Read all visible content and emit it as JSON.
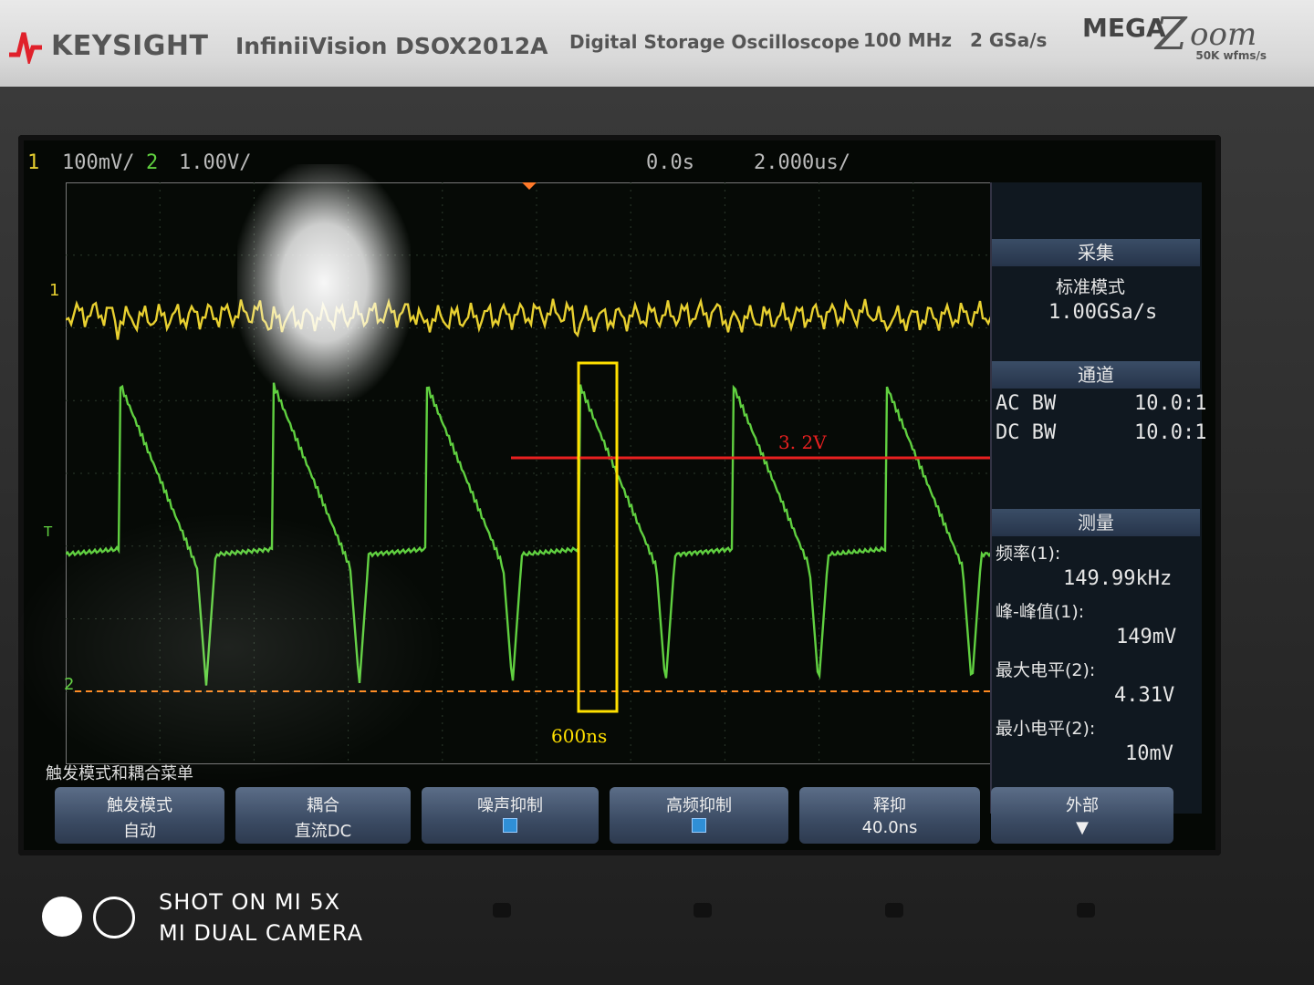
{
  "header": {
    "brand": "KEYSIGHT",
    "model": "InfiniiVision DSOX2012A",
    "description": "Digital Storage Oscilloscope",
    "bandwidth": "100 MHz",
    "sample_rate": "2 GSa/s",
    "mega_word": "MEGA",
    "mega_z": "Z",
    "mega_oom": "oom",
    "mega_sub": "50K wfms/s"
  },
  "top_status": {
    "ch1_num": "1",
    "ch1_scale": "100mV/",
    "ch2_num": "2",
    "ch2_scale": "1.00V/",
    "delay": "0.0s",
    "timebase": "2.000us/"
  },
  "markers": {
    "ch1": "1",
    "ch2": "2",
    "trigger": "T"
  },
  "side_panel": {
    "acquire_title": "采集",
    "acquire_mode": "标准模式",
    "acquire_rate": "1.00GSa/s",
    "channel_title": "通道",
    "ch1_bw": "AC BW",
    "ch1_probe": "10.0:1",
    "ch2_bw": "DC BW",
    "ch2_probe": "10.0:1",
    "measure_title": "测量",
    "m1_label": "频率(1):",
    "m1_value": "149.99kHz",
    "m2_label": "峰-峰值(1):",
    "m2_value": "149mV",
    "m3_label": "最大电平(2):",
    "m3_value": "4.31V",
    "m4_label": "最小电平(2):",
    "m4_value": "10mV"
  },
  "menu": {
    "title": "触发模式和耦合菜单",
    "keys": [
      {
        "l1": "触发模式",
        "l2": "自动"
      },
      {
        "l1": "耦合",
        "l2": "直流DC"
      },
      {
        "l1": "噪声抑制",
        "l2": ""
      },
      {
        "l1": "高频抑制",
        "l2": ""
      },
      {
        "l1": "释抑",
        "l2": "40.0ns"
      },
      {
        "l1": "外部",
        "l2": "▼"
      }
    ]
  },
  "annotations": {
    "voltage": "3. 2V",
    "time": "600ns"
  },
  "watermark": {
    "line1": "SHOT ON MI 5X",
    "line2": "MI DUAL CAMERA"
  },
  "colors": {
    "ch1": "#e8d030",
    "ch2": "#60d040",
    "annotation_line": "#e82020",
    "annotation_box": "#ffe000"
  }
}
